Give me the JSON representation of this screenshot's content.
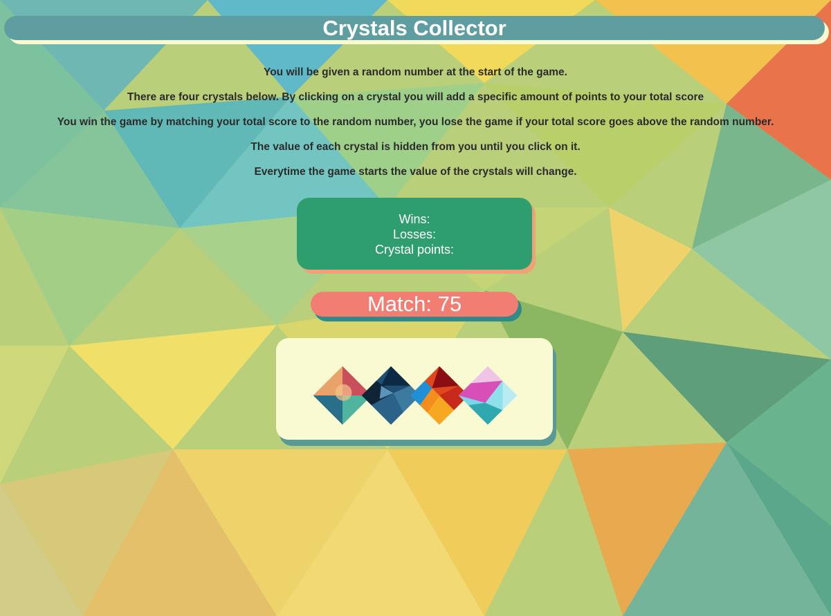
{
  "title": "Crystals Collector",
  "instructions": [
    "You will be given a random number at the start of the game.",
    "There are four crystals below. By clicking on a crystal you will add a specific amount of points to your total score",
    "You win the game by matching your total score to the random number, you lose the game if your total score goes above the random number.",
    "The value of each crystal is hidden from you until you click on it.",
    "Everytime the game starts the value of the crystals will change."
  ],
  "score": {
    "wins_label": "Wins:",
    "losses_label": "Losses:",
    "points_label": "Crystal points:"
  },
  "match": {
    "label": "Match: 75"
  },
  "crystals": [
    {
      "name": "crystal-1",
      "colors": [
        "#c94f5a",
        "#e8a26a",
        "#4fb59e",
        "#2a6f8a"
      ]
    },
    {
      "name": "crystal-2",
      "colors": [
        "#0d2a45",
        "#1f4f73",
        "#3c7aa0",
        "#102438"
      ]
    },
    {
      "name": "crystal-3",
      "colors": [
        "#8b0f12",
        "#e0471c",
        "#f7a823",
        "#1f8fd6"
      ]
    },
    {
      "name": "crystal-4",
      "colors": [
        "#d94fb8",
        "#7ad6e8",
        "#2fa8b0",
        "#f0c4e6"
      ]
    }
  ],
  "colors": {
    "title_bar": "#5f9ea0",
    "score_box": "#2e9e6e",
    "match_box": "#f27d72",
    "crystal_box": "#fafad2"
  }
}
